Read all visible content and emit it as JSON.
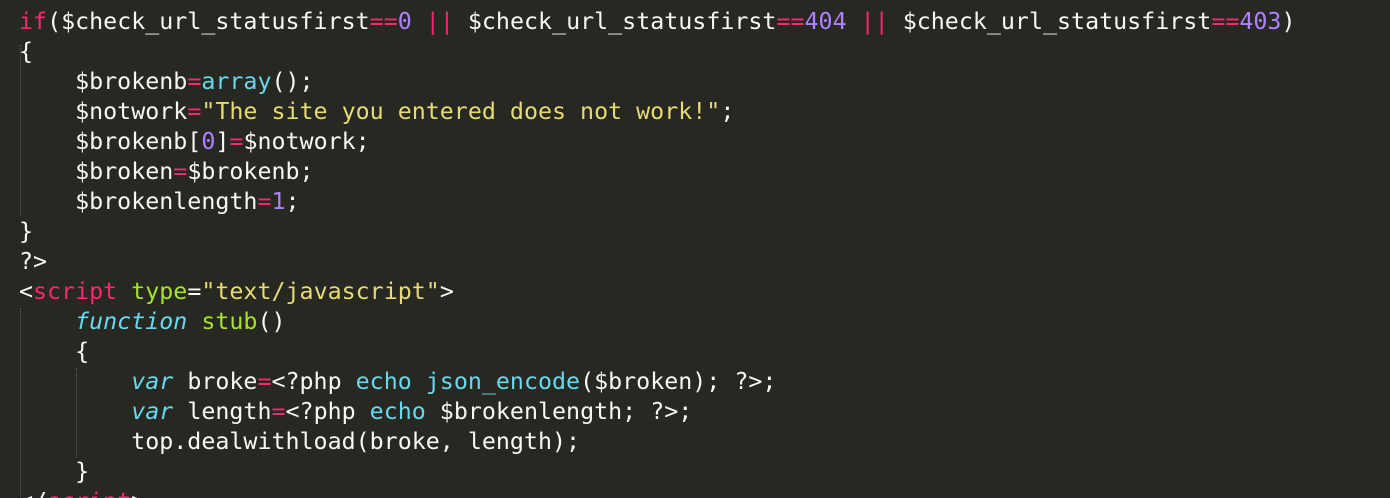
{
  "colors": {
    "background": "#272822",
    "foreground": "#f8f8f2",
    "keyword": "#f92672",
    "number": "#ae81ff",
    "string": "#e6db74",
    "builtin": "#66d9ef",
    "function_name": "#a6e22e"
  },
  "lines": [
    {
      "tokens": [
        {
          "t": "if",
          "c": "kw"
        },
        {
          "t": "($check_url_statusfirst"
        },
        {
          "t": "==",
          "c": "kw"
        },
        {
          "t": "0",
          "c": "num"
        },
        {
          "t": " "
        },
        {
          "t": "||",
          "c": "kw"
        },
        {
          "t": " $check_url_statusfirst"
        },
        {
          "t": "==",
          "c": "kw"
        },
        {
          "t": "404",
          "c": "num"
        },
        {
          "t": " "
        },
        {
          "t": "||",
          "c": "kw"
        },
        {
          "t": " $check_url_statusfirst"
        },
        {
          "t": "==",
          "c": "kw"
        },
        {
          "t": "403",
          "c": "num"
        },
        {
          "t": ")"
        }
      ]
    },
    {
      "tokens": [
        {
          "t": "{"
        }
      ]
    },
    {
      "tokens": [
        {
          "t": "    $brokenb"
        },
        {
          "t": "=",
          "c": "kw"
        },
        {
          "t": "array",
          "c": "fn"
        },
        {
          "t": "();"
        }
      ]
    },
    {
      "tokens": [
        {
          "t": "    $notwork"
        },
        {
          "t": "=",
          "c": "kw"
        },
        {
          "t": "\"The site you entered does not work!\"",
          "c": "str"
        },
        {
          "t": ";"
        }
      ]
    },
    {
      "tokens": [
        {
          "t": "    $brokenb["
        },
        {
          "t": "0",
          "c": "num"
        },
        {
          "t": "]"
        },
        {
          "t": "=",
          "c": "kw"
        },
        {
          "t": "$notwork;"
        }
      ]
    },
    {
      "tokens": [
        {
          "t": "    $broken"
        },
        {
          "t": "=",
          "c": "kw"
        },
        {
          "t": "$brokenb;"
        }
      ]
    },
    {
      "tokens": [
        {
          "t": "    $brokenlength"
        },
        {
          "t": "=",
          "c": "kw"
        },
        {
          "t": "1",
          "c": "num"
        },
        {
          "t": ";"
        }
      ]
    },
    {
      "tokens": [
        {
          "t": "}"
        }
      ]
    },
    {
      "tokens": [
        {
          "t": "?>"
        }
      ]
    },
    {
      "tokens": [
        {
          "t": "<"
        },
        {
          "t": "script",
          "c": "kw"
        },
        {
          "t": " "
        },
        {
          "t": "type",
          "c": "attr"
        },
        {
          "t": "="
        },
        {
          "t": "\"text/javascript\"",
          "c": "str"
        },
        {
          "t": ">"
        }
      ]
    },
    {
      "tokens": [
        {
          "t": "    "
        },
        {
          "t": "function",
          "c": "ital"
        },
        {
          "t": " "
        },
        {
          "t": "stub",
          "c": "fname"
        },
        {
          "t": "()"
        }
      ]
    },
    {
      "tokens": [
        {
          "t": "    {"
        }
      ]
    },
    {
      "tokens": [
        {
          "t": "        "
        },
        {
          "t": "var",
          "c": "ital"
        },
        {
          "t": " broke"
        },
        {
          "t": "=",
          "c": "kw"
        },
        {
          "t": "<?php "
        },
        {
          "t": "echo",
          "c": "fn"
        },
        {
          "t": " "
        },
        {
          "t": "json_encode",
          "c": "fn"
        },
        {
          "t": "($broken); ?>;"
        }
      ]
    },
    {
      "tokens": [
        {
          "t": "        "
        },
        {
          "t": "var",
          "c": "ital"
        },
        {
          "t": " length"
        },
        {
          "t": "=",
          "c": "kw"
        },
        {
          "t": "<?php "
        },
        {
          "t": "echo",
          "c": "fn"
        },
        {
          "t": " $brokenlength; ?>;"
        }
      ]
    },
    {
      "tokens": [
        {
          "t": "        top.dealwithload(broke, length);"
        }
      ]
    },
    {
      "tokens": [
        {
          "t": "    }"
        }
      ]
    },
    {
      "tokens": [
        {
          "t": "</"
        },
        {
          "t": "script",
          "c": "kw"
        },
        {
          "t": ">"
        }
      ]
    }
  ]
}
